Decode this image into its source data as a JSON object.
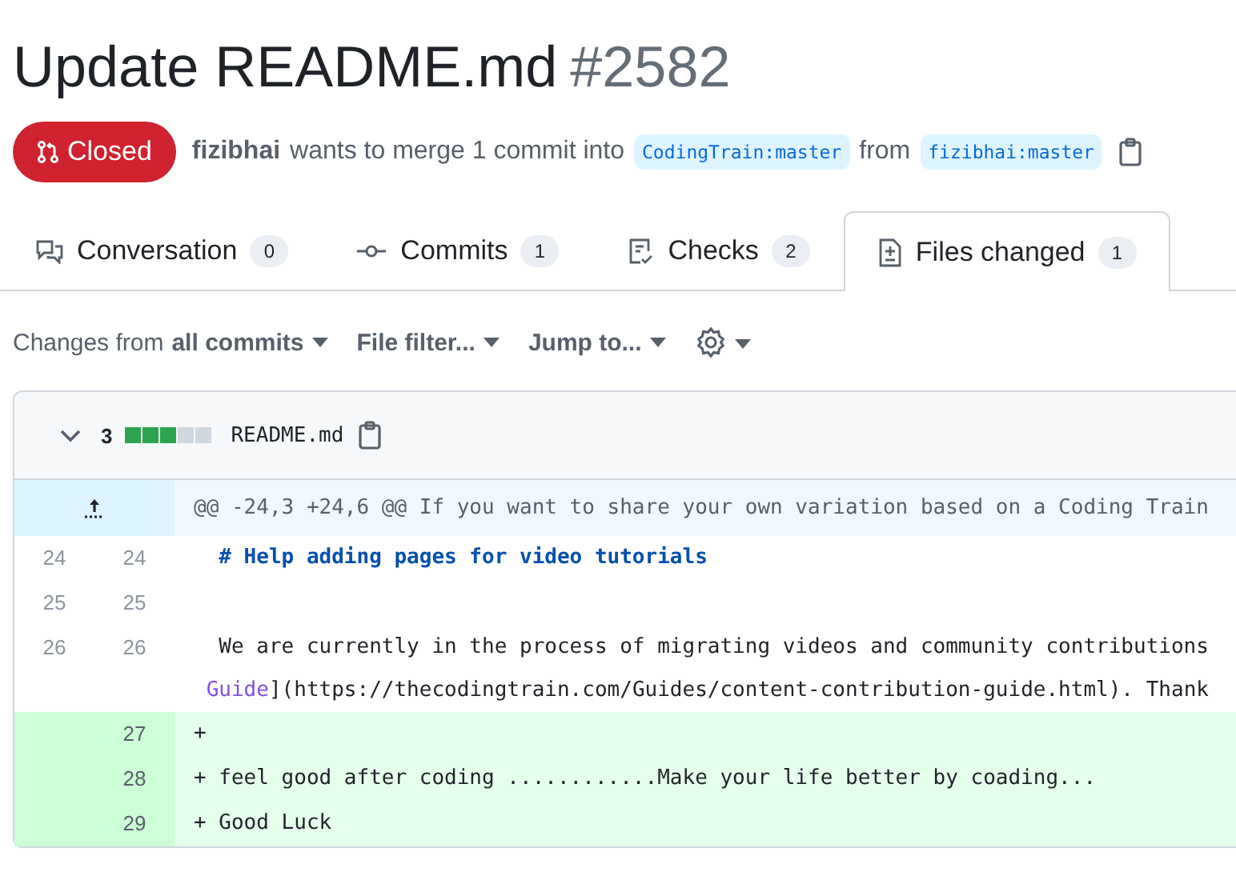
{
  "title": "Update README.md",
  "number": "#2582",
  "state": {
    "label": "Closed",
    "kind": "closed"
  },
  "summary": {
    "author": "fizibhai",
    "text": "wants to merge 1 commit into",
    "base": "CodingTrain:master",
    "from": "from",
    "head": "fizibhai:master"
  },
  "tabs": [
    {
      "label": "Conversation",
      "count": "0",
      "selected": false
    },
    {
      "label": "Commits",
      "count": "1",
      "selected": false
    },
    {
      "label": "Checks",
      "count": "2",
      "selected": false
    },
    {
      "label": "Files changed",
      "count": "1",
      "selected": true
    }
  ],
  "toolbar": {
    "changes_prefix": "Changes from",
    "changes_value": "all commits",
    "file_filter": "File filter...",
    "jump_to": "Jump to..."
  },
  "file": {
    "expanded": true,
    "changes": "3",
    "name": "README.md",
    "diffstat": [
      {
        "kind": "added"
      },
      {
        "kind": "added"
      },
      {
        "kind": "added"
      },
      {
        "kind": "neutral"
      },
      {
        "kind": "neutral"
      }
    ],
    "hunk": "@@ -24,3 +24,6 @@ If you want to share your own variation based on a Coding Train",
    "rows": [
      {
        "kind": "context",
        "old": "24",
        "new": "24",
        "lines": [
          [
            {
              "kind": "heading",
              "text": "  # Help adding pages for video tutorials"
            }
          ]
        ]
      },
      {
        "kind": "context",
        "old": "25",
        "new": "25"
      },
      {
        "kind": "context",
        "old": "26",
        "new": "26",
        "lines": [
          [
            {
              "kind": "plain",
              "text": "  We are currently in the process of migrating videos and community contributions"
            }
          ],
          [
            {
              "kind": "link",
              "text": " Guide"
            },
            {
              "kind": "plain",
              "text": "](https://thecodingtrain.com/Guides/content-contribution-guide.html). Thank"
            }
          ]
        ]
      },
      {
        "kind": "addition",
        "new": "27",
        "lines": [
          [
            {
              "kind": "plain",
              "text": "+"
            }
          ]
        ]
      },
      {
        "kind": "addition",
        "new": "28",
        "lines": [
          [
            {
              "kind": "plain",
              "text": "+ feel good after coding ............Make your life better by coading..."
            }
          ]
        ]
      },
      {
        "kind": "addition",
        "new": "29",
        "lines": [
          [
            {
              "kind": "plain",
              "text": "+ Good Luck"
            }
          ]
        ]
      }
    ]
  }
}
